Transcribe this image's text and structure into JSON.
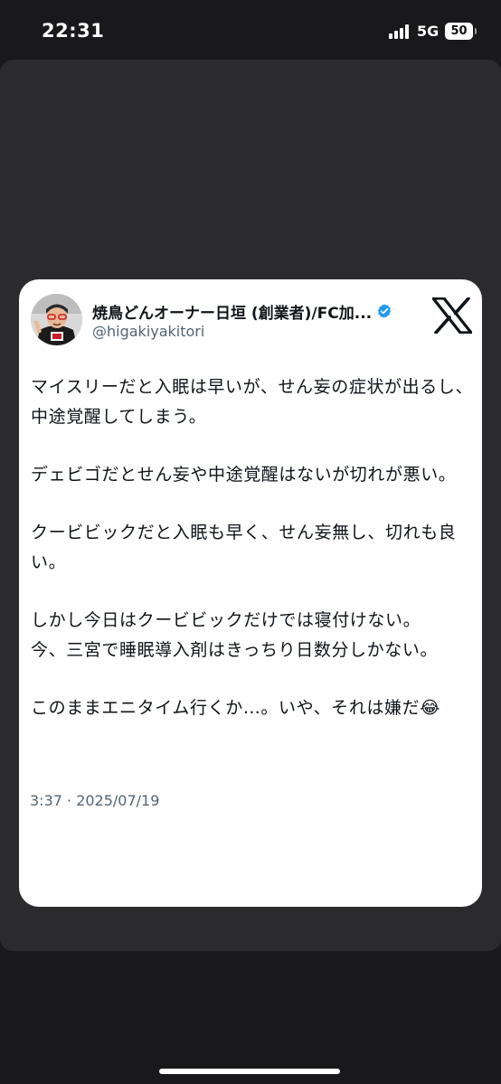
{
  "status_bar": {
    "time": "22:31",
    "network": "5G",
    "battery": "50"
  },
  "tweet": {
    "display_name": "焼鳥どんオーナー日垣 (創業者)/FC加...",
    "handle": "@higakiyakitori",
    "verified": true,
    "brand": "x-logo-icon",
    "paragraphs": [
      "マイスリーだと入眠は早いが、せん妄の症状が出るし、中途覚醒してしまう。",
      "デェビゴだとせん妄や中途覚醒はないが切れが悪い。",
      "クービビックだと入眠も早く、せん妄無し、切れも良い。",
      "しかし今日はクービビックだけでは寝付けない。\n今、三宮で睡眠導入剤はきっちり日数分しかない。",
      "このままエニタイム行くか…。いや、それは嫌だ😂"
    ],
    "timestamp": "3:37 · 2025/07/19"
  },
  "colors": {
    "background": "#19191b",
    "panel": "#2b2b2d",
    "card": "#ffffff",
    "verified_blue": "#1d9bf0",
    "secondary_text": "#536471"
  }
}
